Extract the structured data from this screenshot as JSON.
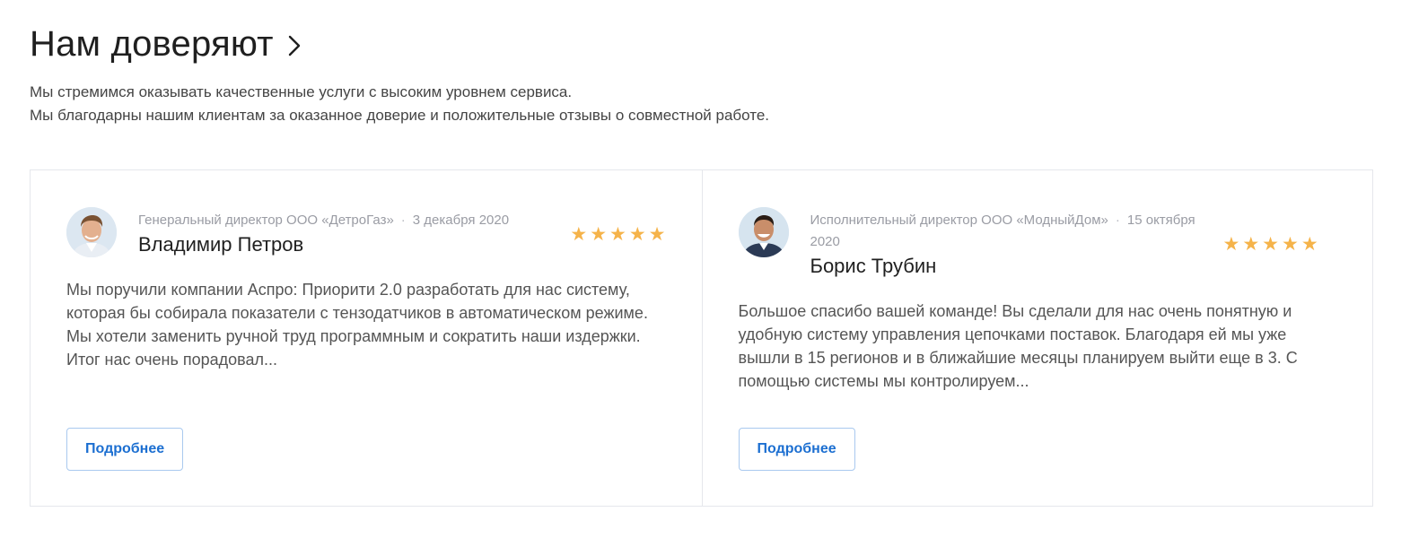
{
  "header": {
    "title": "Нам доверяют",
    "chevron_icon": "chevron-right-icon"
  },
  "intro": {
    "line1": "Мы стремимся оказывать качественные услуги с высоким уровнем сервиса.",
    "line2": "Мы благодарны нашим клиентам за оказанное доверие и положительные отзывы о совместной работе."
  },
  "reviews": [
    {
      "position": "Генеральный директор ООО «ДетроГаз»",
      "date": "3 декабря 2020",
      "author": "Владимир Петров",
      "rating": 5,
      "text": "Мы поручили компании Аспро: Приорити 2.0 разработать для нас систему, которая бы собирала показатели с тензодатчиков в автоматическом режиме. Мы хотели заменить ручной труд программным и сократить наши издержки. Итог нас очень порадовал...",
      "button_label": "Подробнее"
    },
    {
      "position": "Исполнительный директор ООО «МодныйДом»",
      "date": "15 октября 2020",
      "author": "Борис Трубин",
      "rating": 5,
      "text": "Большое спасибо вашей команде! Вы сделали для нас очень понятную и удобную систему управления цепочками поставок. Благодаря ей мы уже вышли в 15 регионов и в ближайшие месяцы планируем выйти еще в 3. С помощью системы мы контролируем...",
      "button_label": "Подробнее"
    }
  ],
  "colors": {
    "accent": "#1c6fd1",
    "star": "#f5b34a",
    "border": "#e5e7ec",
    "muted_text": "#9a9ca4"
  },
  "icons": {
    "star": "star-icon",
    "avatar": "avatar"
  }
}
